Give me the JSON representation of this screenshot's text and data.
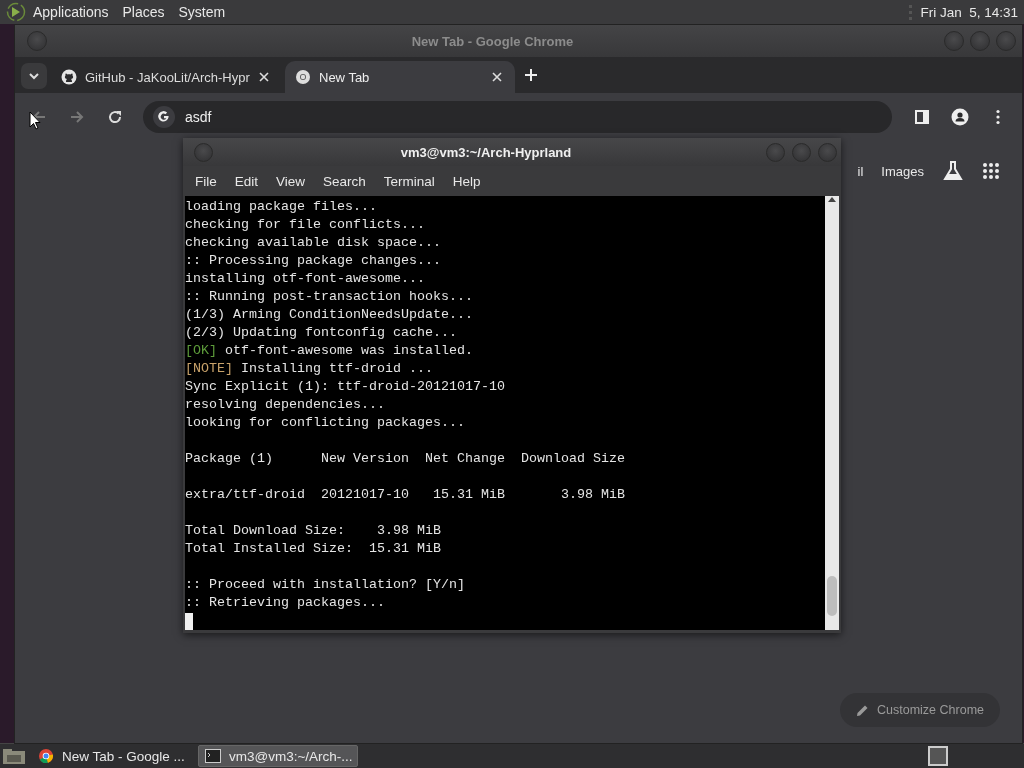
{
  "top_panel": {
    "menus": [
      "Applications",
      "Places",
      "System"
    ],
    "clock": "Fri Jan  5, 14:31"
  },
  "chrome": {
    "title": "New Tab - Google Chrome",
    "tabs": [
      {
        "title": "GitHub - JaKooLit/Arch-Hypr",
        "kind": "github",
        "selected": false
      },
      {
        "title": "New Tab",
        "kind": "chrome",
        "selected": true
      }
    ],
    "address": "asdf",
    "partial_link": "il",
    "images_link": "Images",
    "customize": "Customize Chrome"
  },
  "terminal": {
    "title": "vm3@vm3:~/Arch-Hyprland",
    "menus": [
      "File",
      "Edit",
      "View",
      "Search",
      "Terminal",
      "Help"
    ],
    "lines": [
      {
        "kind": "text",
        "text": "loading package files..."
      },
      {
        "kind": "text",
        "text": "checking for file conflicts..."
      },
      {
        "kind": "text",
        "text": "checking available disk space..."
      },
      {
        "kind": "text",
        "text": ":: Processing package changes..."
      },
      {
        "kind": "text",
        "text": "installing otf-font-awesome..."
      },
      {
        "kind": "text",
        "text": ":: Running post-transaction hooks..."
      },
      {
        "kind": "text",
        "text": "(1/3) Arming ConditionNeedsUpdate..."
      },
      {
        "kind": "text",
        "text": "(2/3) Updating fontconfig cache..."
      },
      {
        "kind": "tagged",
        "tag": "[OK]",
        "color": "#5d9c3a",
        "text": " otf-font-awesome was installed."
      },
      {
        "kind": "tagged",
        "tag": "[NOTE]",
        "color": "#c8a26a",
        "text": " Installing ttf-droid ..."
      },
      {
        "kind": "text",
        "text": "Sync Explicit (1): ttf-droid-20121017-10"
      },
      {
        "kind": "text",
        "text": "resolving dependencies..."
      },
      {
        "kind": "text",
        "text": "looking for conflicting packages..."
      },
      {
        "kind": "blank"
      },
      {
        "kind": "text",
        "text": "Package (1)      New Version  Net Change  Download Size"
      },
      {
        "kind": "blank"
      },
      {
        "kind": "text",
        "text": "extra/ttf-droid  20121017-10   15.31 MiB       3.98 MiB"
      },
      {
        "kind": "blank"
      },
      {
        "kind": "text",
        "text": "Total Download Size:    3.98 MiB"
      },
      {
        "kind": "text",
        "text": "Total Installed Size:  15.31 MiB"
      },
      {
        "kind": "blank"
      },
      {
        "kind": "text",
        "text": ":: Proceed with installation? [Y/n]"
      },
      {
        "kind": "text",
        "text": ":: Retrieving packages..."
      },
      {
        "kind": "cursor"
      }
    ]
  },
  "taskbar": {
    "tasks": [
      {
        "label": "New Tab - Google ...",
        "kind": "browser",
        "selected": false
      },
      {
        "label": "vm3@vm3:~/Arch-...",
        "kind": "terminal",
        "selected": true
      }
    ]
  }
}
